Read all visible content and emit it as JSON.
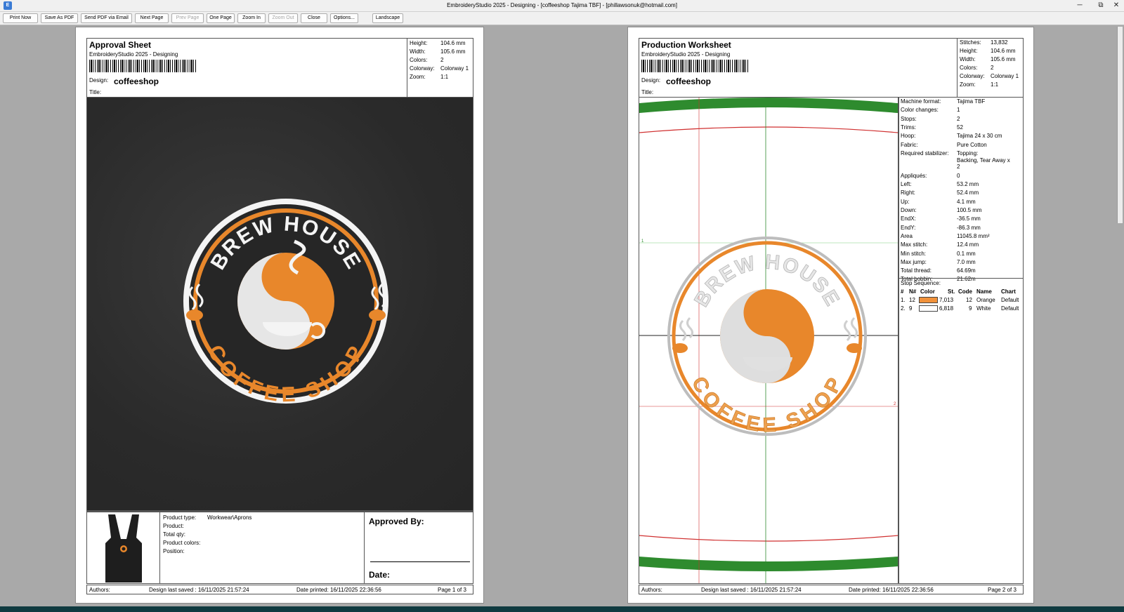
{
  "window": {
    "title": "EmbroideryStudio 2025 - Designing - [coffeeshop        Tajima TBF] - [phillawsonuk@hotmail.com]",
    "icon": "app-icon",
    "min": "─",
    "restore": "⧉",
    "close": "✕"
  },
  "toolbar": {
    "buttons": [
      "Print Now",
      "Save As PDF",
      "Send PDF via Email",
      "Next Page",
      "Prev Page",
      "One Page",
      "Zoom In",
      "Zoom Out",
      "Close",
      "Options...",
      "Landscape"
    ]
  },
  "approval": {
    "title": "Approval Sheet",
    "subtitle": "EmbroideryStudio 2025 - Designing",
    "design_label": "Design:",
    "design_value": "coffeeshop",
    "title_label": "Title:",
    "info": [
      {
        "k": "Height:",
        "v": "104.6 mm"
      },
      {
        "k": "Width:",
        "v": "105.6 mm"
      },
      {
        "k": "Colors:",
        "v": "2"
      },
      {
        "k": "Colorway:",
        "v": "Colorway 1"
      },
      {
        "k": "Zoom:",
        "v": "1:1"
      }
    ],
    "logo": {
      "top": "BREW HOUSE",
      "bottom": "COFFEE SHOP"
    },
    "product": [
      {
        "k": "Product type:",
        "v": "Workwear\\Aprons"
      },
      {
        "k": "Product:",
        "v": ""
      },
      {
        "k": "Total qty:",
        "v": ""
      },
      {
        "k": "Product colors:",
        "v": ""
      },
      {
        "k": "Position:",
        "v": ""
      }
    ],
    "approved_by": "Approved By:",
    "date": "Date:",
    "footer": {
      "authors": "Authors:",
      "saved": "Design last saved : 16/11/2025 21:57:24",
      "printed": "Date printed: 16/11/2025 22:36:56",
      "page": "Page 1 of 3"
    }
  },
  "production": {
    "title": "Production Worksheet",
    "subtitle": "EmbroideryStudio 2025 - Designing",
    "design_label": "Design:",
    "design_value": "coffeeshop",
    "title_label": "Title:",
    "info": [
      {
        "k": "Stitches:",
        "v": "13,832"
      },
      {
        "k": "Height:",
        "v": "104.6 mm"
      },
      {
        "k": "Width:",
        "v": "105.6 mm"
      },
      {
        "k": "Colors:",
        "v": "2"
      },
      {
        "k": "Colorway:",
        "v": "Colorway 1"
      },
      {
        "k": "Zoom:",
        "v": "1:1"
      }
    ],
    "details": [
      {
        "k": "Machine format:",
        "v": "Tajima TBF"
      },
      {
        "k": "Color changes:",
        "v": "1"
      },
      {
        "k": "Stops:",
        "v": "2"
      },
      {
        "k": "Trims:",
        "v": "52"
      },
      {
        "k": "Hoop:",
        "v": "Tajima 24 x 30 cm"
      },
      {
        "k": "Fabric:",
        "v": "Pure Cotton"
      },
      {
        "k": "Required stabilizer:",
        "v": "Topping:",
        "v2": "Backing, Tear Away x",
        "v3": "2"
      },
      {
        "k": "Appliqués:",
        "v": "0"
      },
      {
        "k": "Left:",
        "v": "53.2 mm"
      },
      {
        "k": "Right:",
        "v": "52.4 mm"
      },
      {
        "k": "Up:",
        "v": "4.1 mm"
      },
      {
        "k": "Down:",
        "v": "100.5 mm"
      },
      {
        "k": "EndX:",
        "v": "-36.5 mm"
      },
      {
        "k": "EndY:",
        "v": "-86.3 mm"
      },
      {
        "k": "Area",
        "v": "11045.8 mm²"
      },
      {
        "k": "Max stitch:",
        "v": "12.4 mm"
      },
      {
        "k": "Min stitch:",
        "v": "0.1 mm"
      },
      {
        "k": "Max jump:",
        "v": "7.0 mm"
      },
      {
        "k": "Total thread:",
        "v": "64.69m"
      },
      {
        "k": "Total bobbin:",
        "v": "21.62m"
      }
    ],
    "stop_sequence_label": "Stop Sequence:",
    "seq_headers": [
      "#",
      "N#",
      "Color",
      "St.",
      "Code",
      "Name",
      "Chart"
    ],
    "seq_rows": [
      {
        "num": "1.",
        "n": "12",
        "color": "#f0913a",
        "st": "7,013",
        "code": "12",
        "name": "Orange",
        "chart": "Default"
      },
      {
        "num": "2.",
        "n": "9",
        "color": "#ffffff",
        "st": "6,818",
        "code": "9",
        "name": "White",
        "chart": "Default"
      }
    ],
    "marker_1": "1",
    "marker_2": "2",
    "footer": {
      "authors": "Authors:",
      "saved": "Design last saved : 16/11/2025 21:57:24",
      "printed": "Date printed: 16/11/2025 22:36:56",
      "page": "Page 2 of 3"
    }
  },
  "colors": {
    "orange": "#e8872b",
    "white": "#f2f2f2",
    "green": "#2e8b2e",
    "red": "#d03030"
  }
}
